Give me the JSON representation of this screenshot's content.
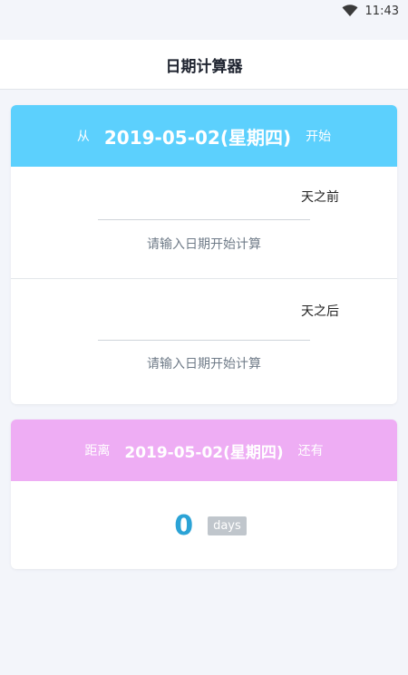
{
  "status_bar": {
    "time": "11:43"
  },
  "app_bar": {
    "title": "日期计算器"
  },
  "calc_card": {
    "header": {
      "prefix": "从",
      "date": "2019-05-02(星期四)",
      "suffix": "开始"
    },
    "before": {
      "label": "天之前",
      "input_value": "",
      "result": "请输入日期开始计算"
    },
    "after": {
      "label": "天之后",
      "input_value": "",
      "result": "请输入日期开始计算"
    }
  },
  "countdown_card": {
    "header": {
      "prefix": "距离",
      "date": "2019-05-02(星期四)",
      "suffix": "还有"
    },
    "days_value": "0",
    "days_unit": "days"
  },
  "colors": {
    "calc_header": "#5cd0fd",
    "countdown_header": "#eeadf4",
    "days_number": "#2ba3d6",
    "days_badge": "#c0c6cc"
  },
  "icons": {
    "wifi": "wifi-icon"
  }
}
